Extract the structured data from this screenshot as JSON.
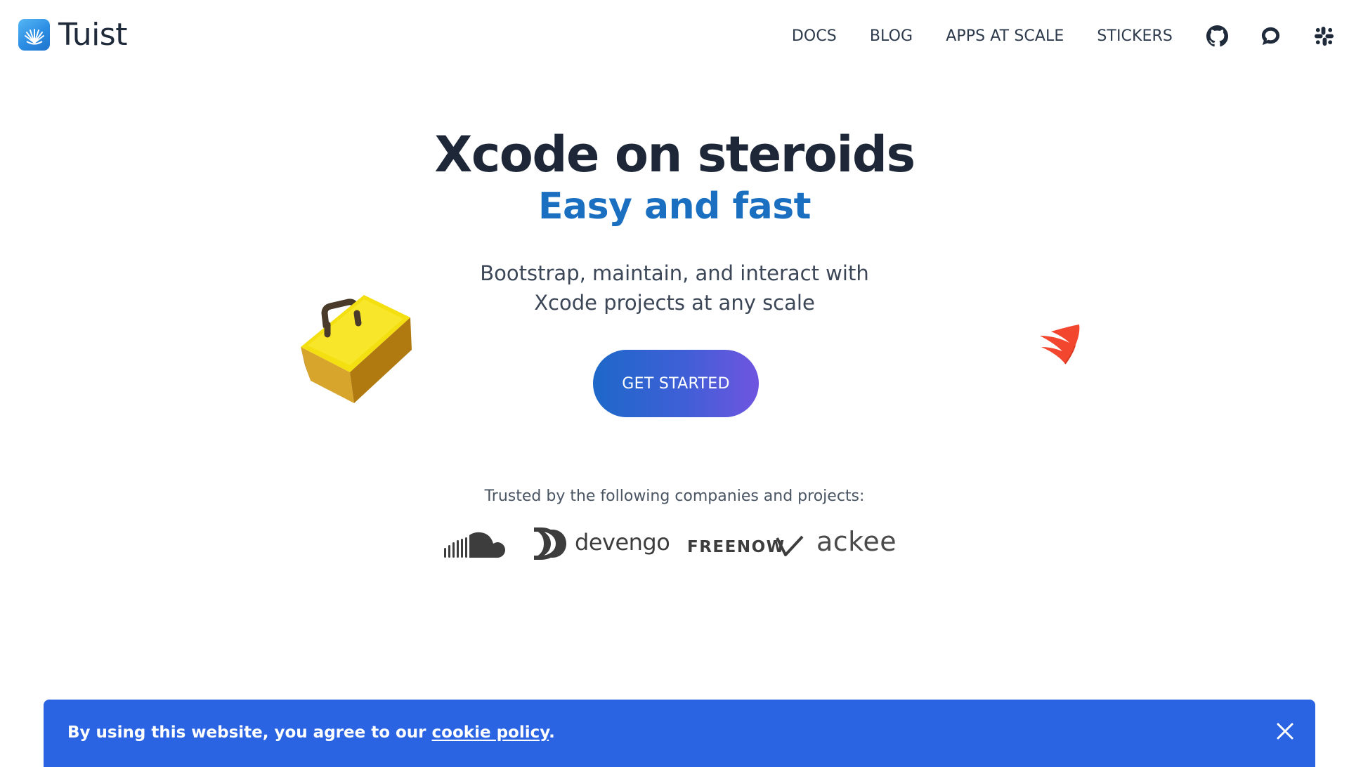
{
  "header": {
    "brand_name": "Tuist",
    "nav": [
      {
        "label": "DOCS"
      },
      {
        "label": "BLOG"
      },
      {
        "label": "APPS AT SCALE"
      },
      {
        "label": "STICKERS"
      }
    ],
    "icons": [
      "github-icon",
      "chat-icon",
      "slack-icon"
    ]
  },
  "hero": {
    "title": "Xcode on steroids",
    "subtitle": "Easy and fast",
    "description": "Bootstrap, maintain, and interact with Xcode projects at any scale",
    "cta_label": "GET STARTED"
  },
  "trusted": {
    "label": "Trusted by the following companies and projects:",
    "logos": {
      "soundcloud": "soundcloud-logo",
      "devengo": "devengo",
      "freenow": "FREENOW",
      "ackee": "ackee"
    }
  },
  "cookie": {
    "text_before": "By using this website, you agree to our ",
    "link": "cookie policy",
    "text_after": "."
  },
  "colors": {
    "accent": "#1a6fc0",
    "title": "#1d2737",
    "cookie_bg": "#2b64e3",
    "cta_gradient_start": "#1d68c9",
    "cta_gradient_end": "#6f55e0"
  }
}
